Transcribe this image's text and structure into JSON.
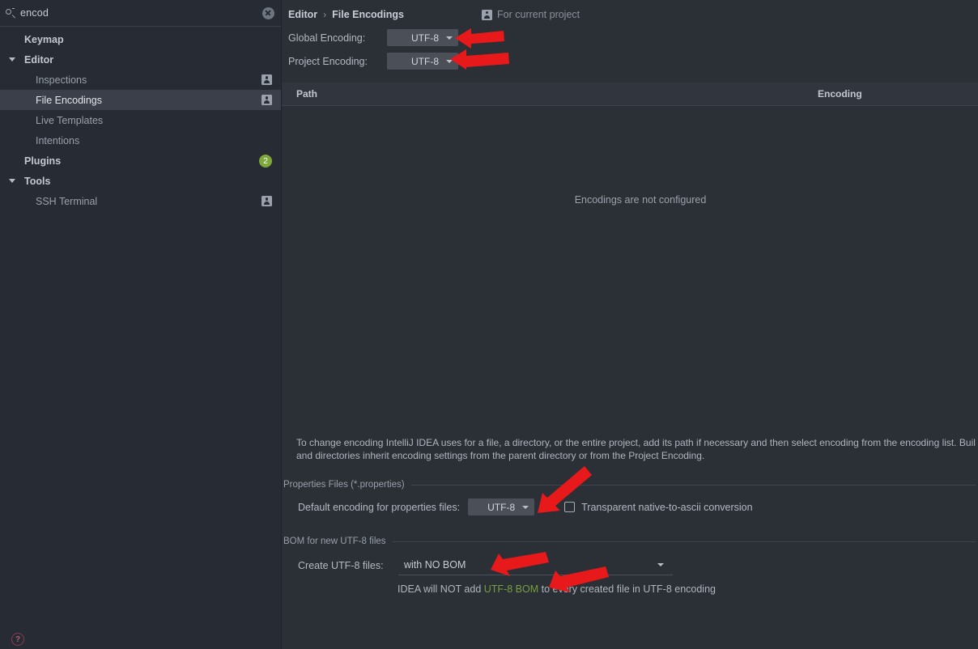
{
  "search": {
    "value": "encod",
    "icon": "search-icon",
    "clear_icon": "clear-icon"
  },
  "sidebar": {
    "items": [
      {
        "label": "Keymap",
        "level": 0,
        "bold": true,
        "twisty": false,
        "badge": null,
        "person": false,
        "selected": false
      },
      {
        "label": "Editor",
        "level": 0,
        "bold": true,
        "twisty": true,
        "badge": null,
        "person": false,
        "selected": false
      },
      {
        "label": "Inspections",
        "level": 1,
        "bold": false,
        "twisty": false,
        "badge": null,
        "person": true,
        "selected": false
      },
      {
        "label": "File Encodings",
        "level": 1,
        "bold": false,
        "twisty": false,
        "badge": null,
        "person": true,
        "selected": true
      },
      {
        "label": "Live Templates",
        "level": 1,
        "bold": false,
        "twisty": false,
        "badge": null,
        "person": false,
        "selected": false
      },
      {
        "label": "Intentions",
        "level": 1,
        "bold": false,
        "twisty": false,
        "badge": null,
        "person": false,
        "selected": false
      },
      {
        "label": "Plugins",
        "level": 0,
        "bold": true,
        "twisty": false,
        "badge": "2",
        "person": false,
        "selected": false
      },
      {
        "label": "Tools",
        "level": 0,
        "bold": true,
        "twisty": true,
        "badge": null,
        "person": false,
        "selected": false
      },
      {
        "label": "SSH Terminal",
        "level": 1,
        "bold": false,
        "twisty": false,
        "badge": null,
        "person": true,
        "selected": false
      }
    ],
    "help_icon_label": "?"
  },
  "header": {
    "crumb_parent": "Editor",
    "crumb_separator": "›",
    "crumb_current": "File Encodings",
    "scope_label": "For current project",
    "scope_icon": "user-icon"
  },
  "encodings": {
    "global_label": "Global Encoding:",
    "global_value": "UTF-8",
    "project_label": "Project Encoding:",
    "project_value": "UTF-8"
  },
  "table": {
    "col_path": "Path",
    "col_encoding": "Encoding",
    "empty_message": "Encodings are not configured"
  },
  "description": {
    "line1": "To change encoding IntelliJ IDEA uses for a file, a directory, or the entire project, add its path if necessary and then select encoding from the encoding list. Buil",
    "line2": "and directories inherit encoding settings from the parent directory or from the Project Encoding."
  },
  "properties_section": {
    "title": "Properties Files (*.properties)",
    "default_encoding_label": "Default encoding for properties files:",
    "default_encoding_value": "UTF-8",
    "transparent_label": "Transparent native-to-ascii conversion",
    "transparent_checked": false
  },
  "bom_section": {
    "title": "BOM for new UTF-8 files",
    "create_label": "Create UTF-8 files:",
    "create_value": "with NO BOM",
    "hint_prefix": "IDEA will NOT add ",
    "hint_highlight": "UTF-8 BOM",
    "hint_suffix": " to every created file in UTF-8 encoding"
  },
  "colors": {
    "background": "#2b2f36",
    "sidebar": "#272b33",
    "selection": "#3b3f4a",
    "badge_green": "#7fa73c",
    "hint_green": "#77a03f",
    "annotation_red": "#e8191a"
  },
  "annotations": {
    "arrow_count": 5,
    "arrow_color": "#e8191a"
  }
}
